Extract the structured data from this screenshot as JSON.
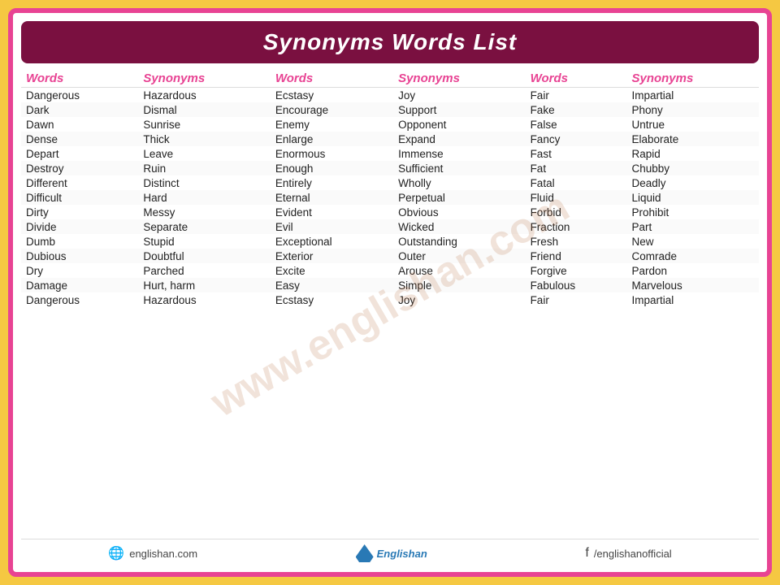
{
  "title": "Synonyms Words List",
  "watermark": "www.englishan.com",
  "columns": [
    {
      "header": "Words",
      "key": "w1"
    },
    {
      "header": "Synonyms",
      "key": "s1"
    },
    {
      "header": "Words",
      "key": "w2"
    },
    {
      "header": "Synonyms",
      "key": "s2"
    },
    {
      "header": "Words",
      "key": "w3"
    },
    {
      "header": "Synonyms",
      "key": "s3"
    }
  ],
  "rows": [
    [
      "Dangerous",
      "Hazardous",
      "Ecstasy",
      "Joy",
      "Fair",
      "Impartial"
    ],
    [
      "Dark",
      "Dismal",
      "Encourage",
      "Support",
      "Fake",
      "Phony"
    ],
    [
      "Dawn",
      "Sunrise",
      "Enemy",
      "Opponent",
      "False",
      "Untrue"
    ],
    [
      "Dense",
      "Thick",
      "Enlarge",
      "Expand",
      "Fancy",
      "Elaborate"
    ],
    [
      "Depart",
      "Leave",
      "Enormous",
      "Immense",
      "Fast",
      "Rapid"
    ],
    [
      "Destroy",
      "Ruin",
      "Enough",
      "Sufficient",
      "Fat",
      "Chubby"
    ],
    [
      "Different",
      "Distinct",
      "Entirely",
      "Wholly",
      "Fatal",
      "Deadly"
    ],
    [
      "Difficult",
      "Hard",
      "Eternal",
      "Perpetual",
      "Fluid",
      "Liquid"
    ],
    [
      "Dirty",
      "Messy",
      "Evident",
      "Obvious",
      "Forbid",
      "Prohibit"
    ],
    [
      "Divide",
      "Separate",
      "Evil",
      "Wicked",
      "Fraction",
      "Part"
    ],
    [
      "Dumb",
      "Stupid",
      "Exceptional",
      "Outstanding",
      "Fresh",
      "New"
    ],
    [
      "Dubious",
      "Doubtful",
      "Exterior",
      "Outer",
      "Friend",
      "Comrade"
    ],
    [
      "Dry",
      "Parched",
      "Excite",
      "Arouse",
      "Forgive",
      "Pardon"
    ],
    [
      "Damage",
      "Hurt, harm",
      "Easy",
      "Simple",
      "Fabulous",
      "Marvelous"
    ],
    [
      "Dangerous",
      "Hazardous",
      "Ecstasy",
      "Joy",
      "Fair",
      "Impartial"
    ]
  ],
  "footer": {
    "website": "englishan.com",
    "brand": "Englishan",
    "social": "/englishanofficial"
  }
}
